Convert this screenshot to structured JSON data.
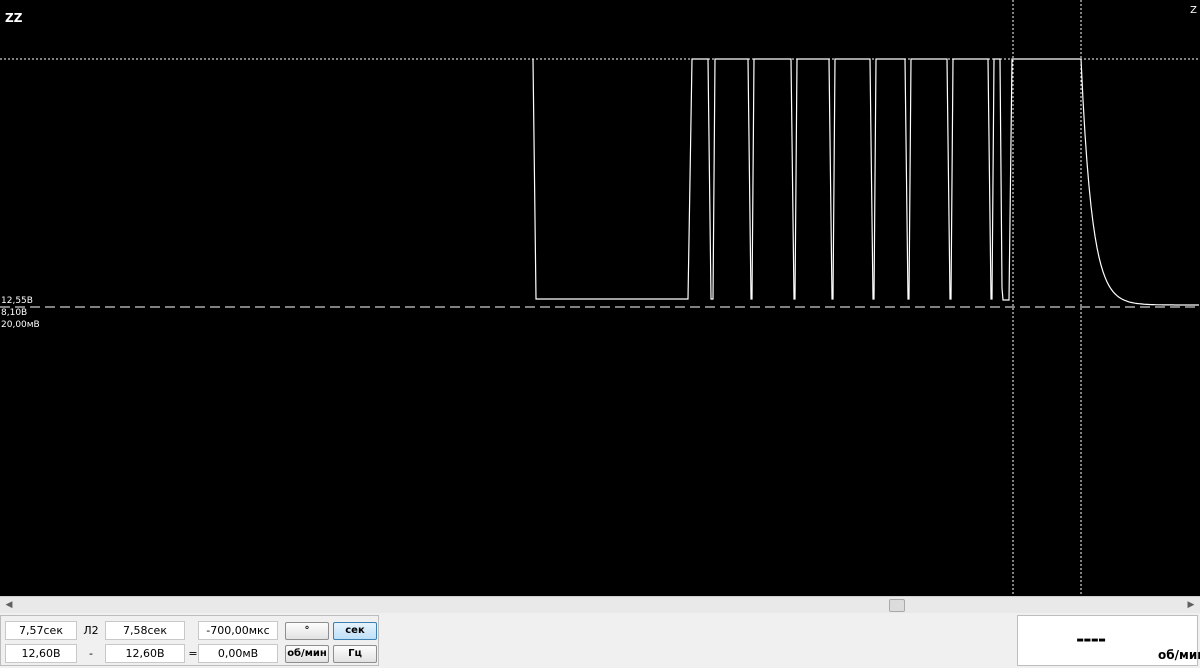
{
  "scope": {
    "channel_label": "ZZ",
    "corner_label": "Z",
    "trace_upper_level": "12,55В",
    "offset_label": "8,10В",
    "scale_label": "20,00мВ",
    "colors": {
      "background": "#000000",
      "trace": "#ffffff"
    }
  },
  "chart_data": {
    "type": "line",
    "description": "single white oscilloscope trace, square pulses then exponential decay"
  },
  "scrollbar": {
    "left_icon": "arrow-left-icon",
    "right_icon": "arrow-right-icon",
    "position": 0.745
  },
  "measurements": {
    "row1": {
      "t1": "7,57сек",
      "mid_label": "Л2",
      "t2": "7,58сек",
      "diff": "-700,00мкс"
    },
    "row2": {
      "v1": "12,60В",
      "mid_label": "-",
      "v2": "12,60В",
      "eq": "=",
      "diff": "0,00мВ"
    },
    "buttons": {
      "degree": "°",
      "sec": "сек",
      "rpm": "об/мин",
      "hz": "Гц"
    }
  },
  "rpm_display": {
    "value": "----",
    "unit": "об/мин"
  }
}
